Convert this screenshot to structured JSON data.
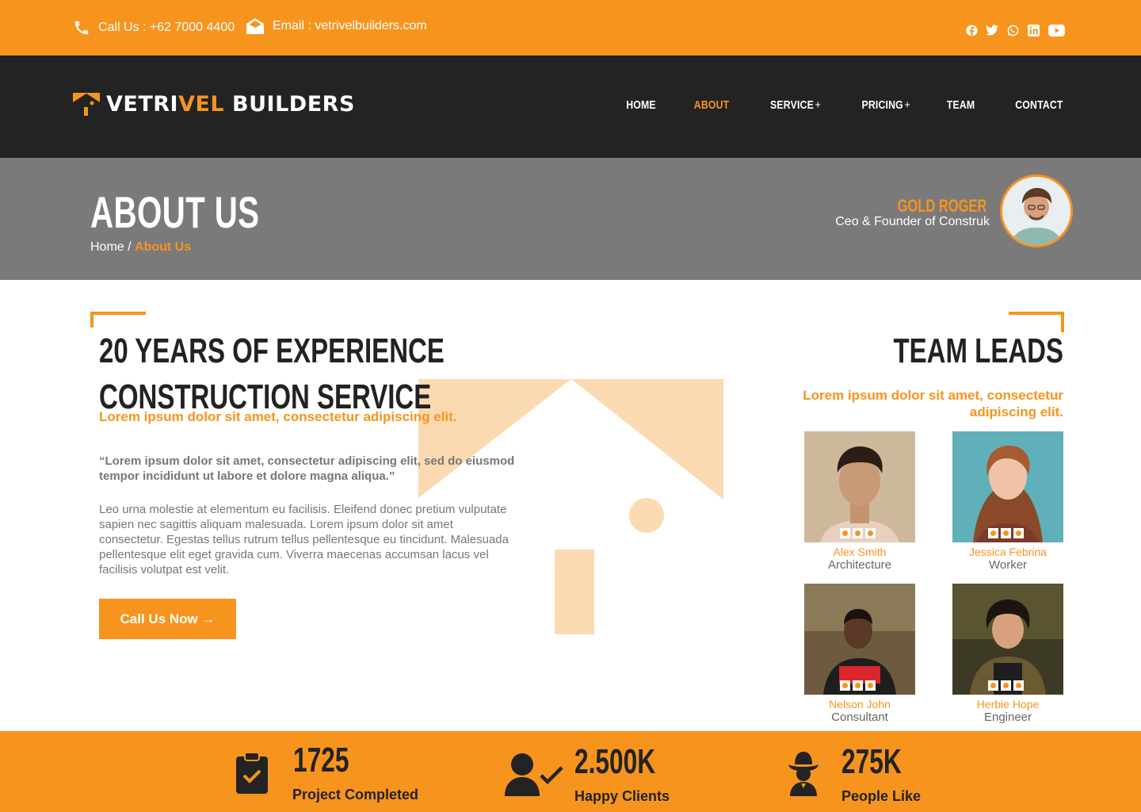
{
  "topbar": {
    "phone": "Call Us : +62 7000 4400",
    "email": "Email : vetrivelbuilders.com",
    "socials": [
      "facebook-icon",
      "twitter-icon",
      "whatsapp-icon",
      "linkedin-icon",
      "youtube-icon"
    ]
  },
  "header": {
    "logo_part1": "VETRI",
    "logo_accent": "VEL",
    "logo_part2": " BUILDERS",
    "nav": [
      {
        "label": "HOME"
      },
      {
        "label": "ABOUT"
      },
      {
        "label": "SERVICE",
        "plus": "+"
      },
      {
        "label": "PRICING",
        "plus": "+"
      },
      {
        "label": "TEAM"
      },
      {
        "label": "CONTACT"
      }
    ]
  },
  "hero": {
    "title": "ABOUT US",
    "breadcrumb_home": "Home",
    "breadcrumb_sep": " / ",
    "breadcrumb_current": "About Us",
    "ceo_name": "GOLD ROGER",
    "ceo_role": "Ceo & Founder of Construk"
  },
  "main": {
    "title_line1": "20 YEARS OF EXPERIENCE",
    "title_line2": "CONSTRUCTION SERVICE",
    "subtitle": "Lorem ipsum dolor sit amet, consectetur adipiscing elit.",
    "quote": "“Lorem ipsum dolor sit amet, consectetur adipiscing elit, sed do eiusmod tempor incididunt ut labore et dolore magna aliqua.”",
    "body": "Leo urna molestie at elementum eu facilisis. Eleifend donec pretium vulputate sapien nec sagittis aliquam malesuada. Lorem ipsum dolor sit amet consectetur. Egestas tellus rutrum tellus pellentesque eu tincidunt. Malesuada pellentesque elit eget gravida cum. Viverra maecenas accumsan lacus vel facilisis volutpat est velit.",
    "cta": "Call Us Now →"
  },
  "team": {
    "title": "TEAM LEADS",
    "subtitle": "Lorem ipsum dolor sit amet, consectetur adipiscing elit.",
    "members": [
      {
        "name": "Alex Smith",
        "role": "Architecture"
      },
      {
        "name": "Jessica Febrina",
        "role": "Worker"
      },
      {
        "name": "Nelson John",
        "role": "Consultant"
      },
      {
        "name": "Herbie Hope",
        "role": "Engineer"
      }
    ]
  },
  "stats": [
    {
      "value": "1725",
      "label": "Project Completed",
      "icon": "clipboard-check-icon"
    },
    {
      "value": "2.500K",
      "label": "Happy Clients",
      "icon": "user-check-icon"
    },
    {
      "value": "275K",
      "label": "People Like",
      "icon": "cowboy-icon"
    }
  ],
  "colors": {
    "accent": "#F7941E",
    "dark": "#232323",
    "hero": "#7A7A7A"
  }
}
